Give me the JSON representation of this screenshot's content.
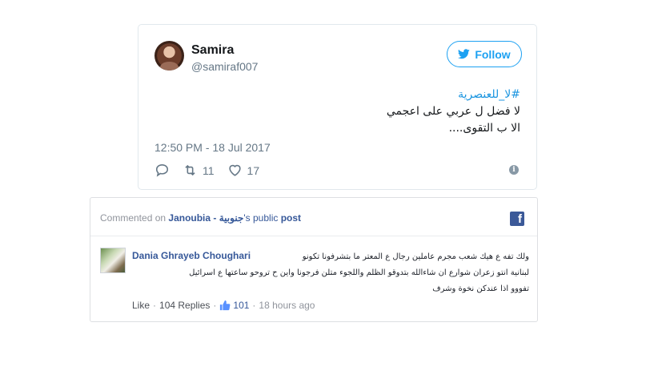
{
  "tweet": {
    "name": "Samira",
    "handle": "@samiraf007",
    "follow_label": "Follow",
    "hashtag": "#لا_للعنصرية",
    "line1": "لا فضل ل عربي على اعجمي",
    "line2": "الا ب التقوى....",
    "timestamp": "12:50 PM - 18 Jul 2017",
    "retweets": "11",
    "likes": "17",
    "info_glyph": "i",
    "accent_color": "#1da1f2"
  },
  "fb": {
    "header_prefix": "Commented on ",
    "page_name": "Janoubia - جنوبية",
    "header_mid": "'s public ",
    "header_link": "post",
    "logo_glyph": "f",
    "commenter_name": "Dania Ghrayeb Choughari",
    "comment_line1": "ولك تفه ع هيك شعب مجرم عاملين رجال ع المعتر ما بتشرفونا تكونو",
    "comment_line2": "لبنانية انتو زعران شوارع ان شاءالله بتدوقو الظلم واللجوء متلن فرجونا واين ح تروحو ساعتها ع اسرائيل",
    "comment_line3": "تفووو اذا عندكن نخوة وشرف",
    "like_label": "Like",
    "replies_label": "104 Replies",
    "like_count": "101",
    "time_ago": "18 hours ago",
    "sep": "·",
    "brand_color": "#3b5998"
  }
}
